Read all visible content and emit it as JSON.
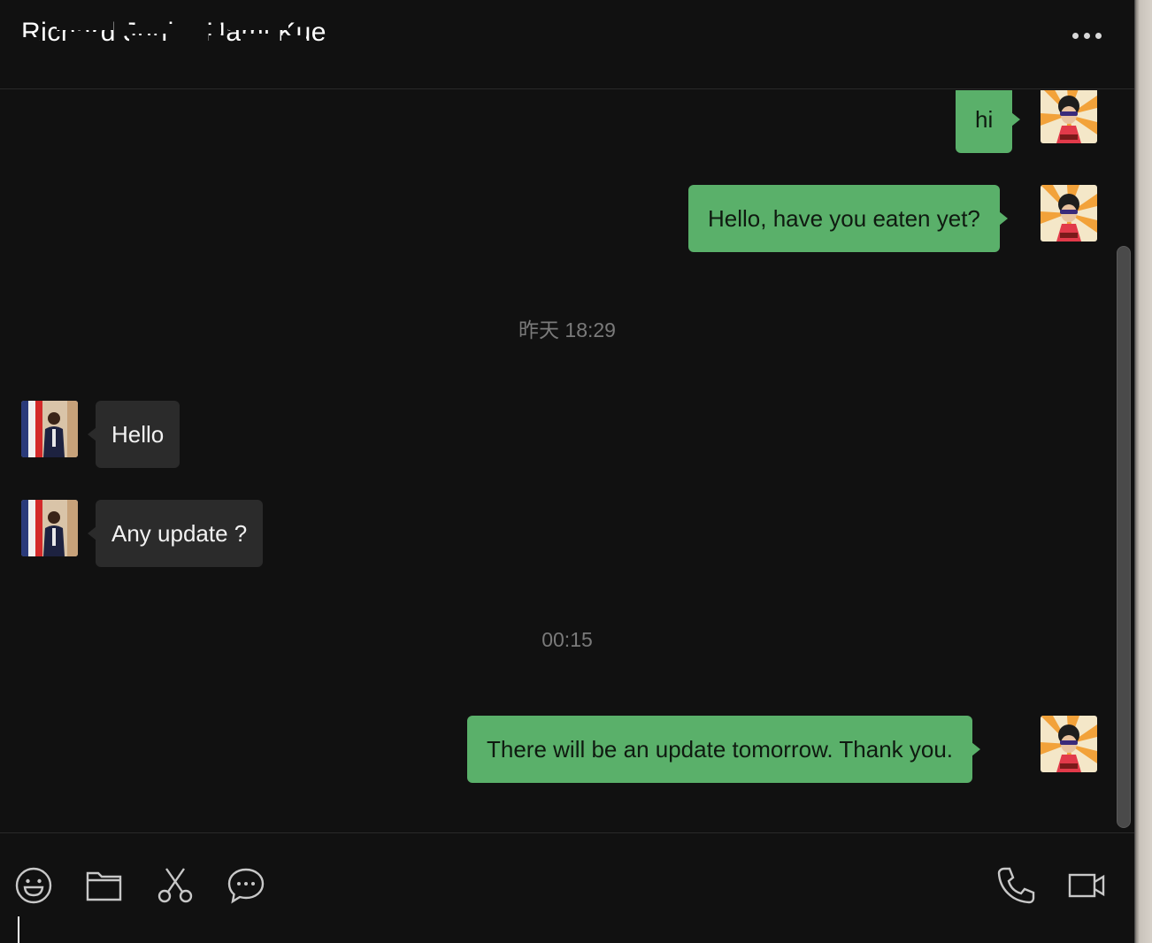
{
  "header": {
    "contact_name": "Richard Junior Hami Kue"
  },
  "messages": [
    {
      "direction": "out",
      "text": "hi"
    },
    {
      "direction": "out",
      "text": "Hello, have you eaten yet?"
    },
    {
      "timestamp": "昨天 18:29"
    },
    {
      "direction": "in",
      "text": "Hello"
    },
    {
      "direction": "in",
      "text": "Any update ?"
    },
    {
      "timestamp": "00:15"
    },
    {
      "direction": "out",
      "text": "There will be an update tomorrow. Thank you."
    }
  ],
  "icons": {
    "more": "more-icon",
    "emoji": "emoji-icon",
    "folder": "folder-icon",
    "scissors": "scissors-icon",
    "chat": "chat-bubble-icon",
    "phone": "phone-icon",
    "video": "video-camera-icon"
  },
  "colors": {
    "background": "#111111",
    "outgoing_bubble": "#5ab06a",
    "incoming_bubble": "#2b2b2b",
    "timestamp": "#7a7a7a",
    "icon": "#c8c8c8"
  }
}
